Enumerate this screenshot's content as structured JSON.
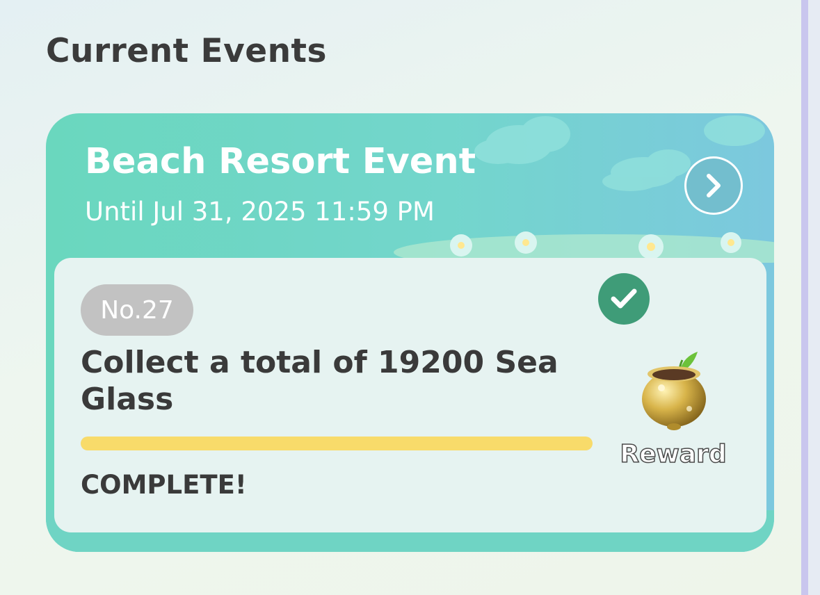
{
  "section": {
    "title": "Current Events"
  },
  "event": {
    "title": "Beach Resort Event",
    "date": "Until Jul 31, 2025 11:59 PM",
    "open_icon": "chevron-right-icon",
    "mission": {
      "number": "No.27",
      "title": "Collect a total of 19200 Sea Glass",
      "progress_percent": 100,
      "status": "COMPLETE!",
      "completed_icon": "checkmark-icon",
      "reward_icon": "golden-pot-sprout-icon",
      "reward_label": "Reward"
    }
  },
  "colors": {
    "card": "#6ad7be",
    "progress": "#f8db6a",
    "check": "#3f9c78",
    "badge": "#c2c2c2"
  }
}
